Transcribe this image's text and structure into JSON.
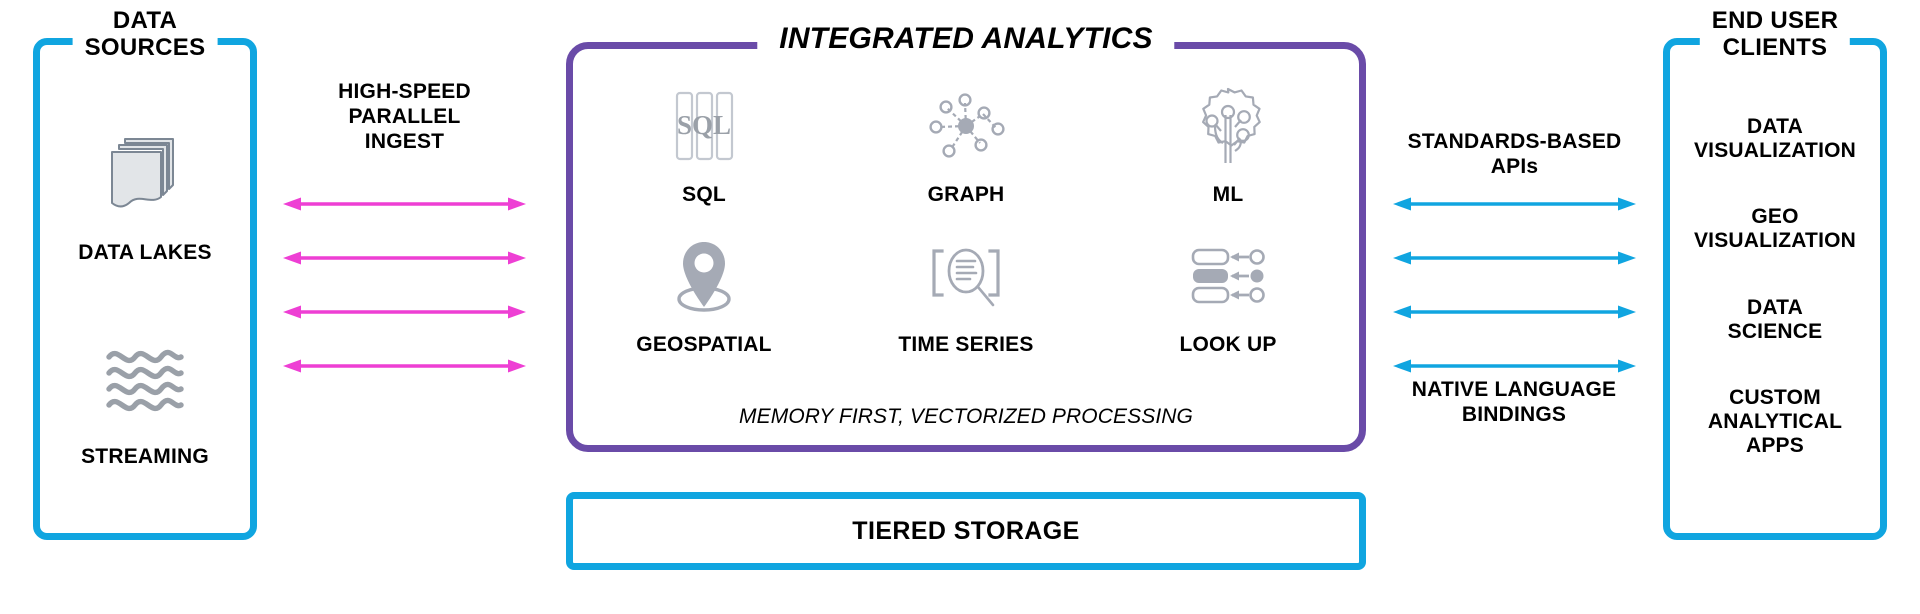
{
  "colors": {
    "blue": "#10A5E0",
    "purple": "#6A4BA8",
    "magenta": "#EE3FD4",
    "icon_gray": "#A5AAB5",
    "text": "#000000"
  },
  "data_sources": {
    "title": "DATA\nSOURCES",
    "title_line1": "DATA",
    "title_line2": "SOURCES",
    "items": [
      {
        "label": "DATA LAKES",
        "icon": "stacked-documents-icon"
      },
      {
        "label": "STREAMING",
        "icon": "wave-lines-icon"
      }
    ]
  },
  "ingest": {
    "caption_line1": "HIGH-SPEED",
    "caption_line2": "PARALLEL",
    "caption_line3": "INGEST",
    "arrow_count": 4,
    "arrow_color": "#EE3FD4",
    "arrow_style": "double-headed"
  },
  "integrated_analytics": {
    "title": "INTEGRATED ANALYTICS",
    "capabilities": [
      {
        "label": "SQL",
        "icon": "sql-columns-icon"
      },
      {
        "label": "GRAPH",
        "icon": "graph-network-icon"
      },
      {
        "label": "ML",
        "icon": "gear-circuit-tree-icon"
      },
      {
        "label": "GEOSPATIAL",
        "icon": "map-pin-icon"
      },
      {
        "label": "TIME SERIES",
        "icon": "magnifier-document-icon"
      },
      {
        "label": "LOOK UP",
        "icon": "lookup-rows-icon"
      }
    ],
    "footnote": "MEMORY FIRST, VECTORIZED PROCESSING"
  },
  "tiered_storage": {
    "label": "TIERED STORAGE"
  },
  "client_interfaces": {
    "top_caption_line1": "STANDARDS-BASED",
    "top_caption_line2": "APIs",
    "bottom_caption_line1": "NATIVE LANGUAGE",
    "bottom_caption_line2": "BINDINGS",
    "arrow_count": 4,
    "arrow_color": "#10A5E0",
    "arrow_style": "double-headed"
  },
  "end_user_clients": {
    "title_line1": "END USER",
    "title_line2": "CLIENTS",
    "items": [
      {
        "line1": "DATA",
        "line2": "VISUALIZATION",
        "line3": ""
      },
      {
        "line1": "GEO",
        "line2": "VISUALIZATION",
        "line3": ""
      },
      {
        "line1": "DATA",
        "line2": "SCIENCE",
        "line3": ""
      },
      {
        "line1": "CUSTOM",
        "line2": "ANALYTICAL",
        "line3": "APPS"
      }
    ]
  }
}
